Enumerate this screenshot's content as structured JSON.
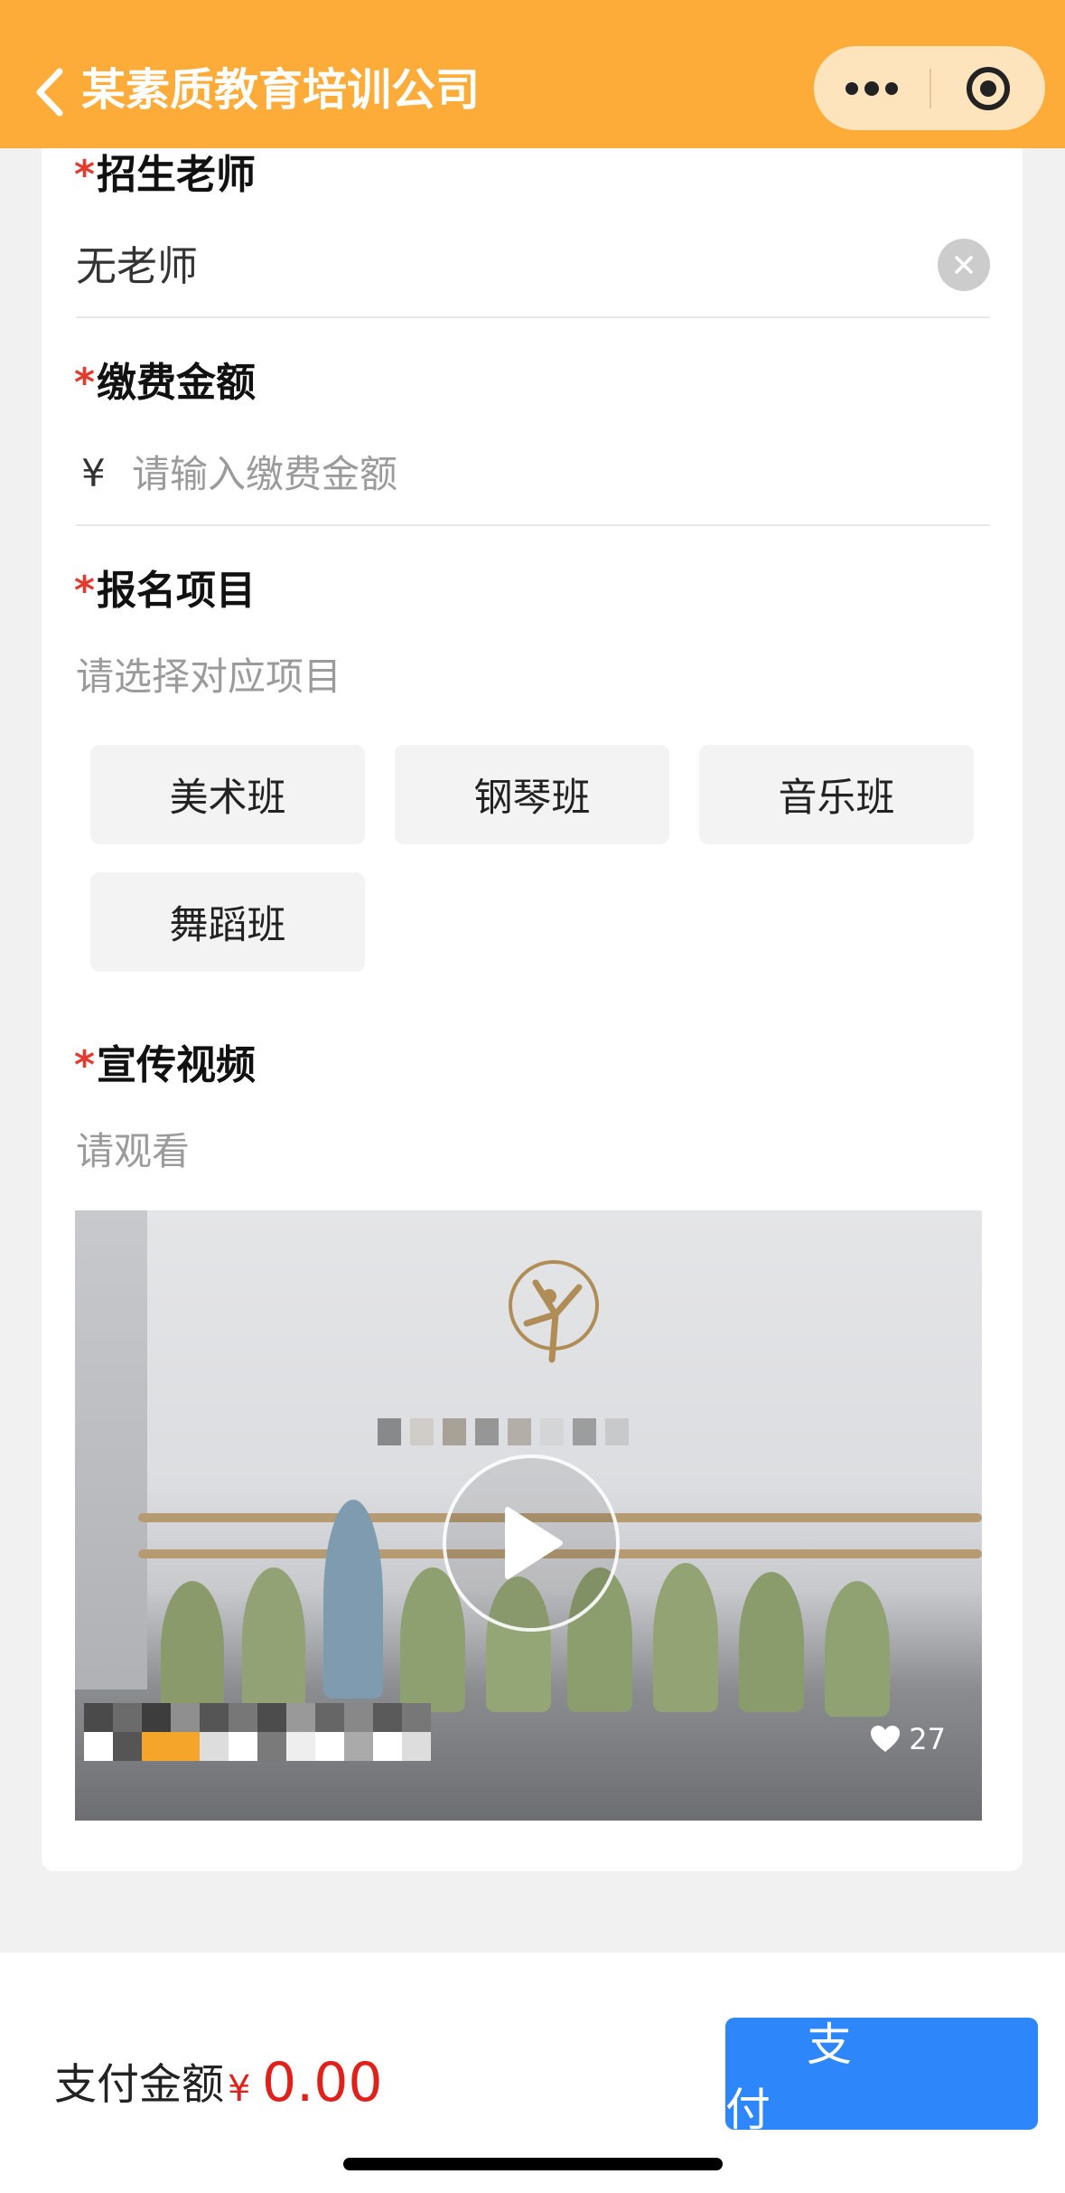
{
  "navbar": {
    "title": "某素质教育培训公司",
    "back_icon": "chevron-left-icon",
    "more_icon": "more-dots-icon",
    "close_icon": "target-circle-icon",
    "background_color": "#FDAC3A"
  },
  "form": {
    "required_mark": "*",
    "teacher": {
      "label": "招生老师",
      "value": "无老师",
      "clear_icon": "clear-icon"
    },
    "amount": {
      "label": "缴费金额",
      "currency_symbol": "¥",
      "placeholder": "请输入缴费金额",
      "value": ""
    },
    "project": {
      "label": "报名项目",
      "hint": "请选择对应项目",
      "options": [
        "美术班",
        "钢琴班",
        "音乐班",
        "舞蹈班"
      ]
    },
    "video": {
      "label": "宣传视频",
      "hint": "请观看",
      "play_icon": "play-icon",
      "like_icon": "heart-icon",
      "like_count": "27"
    }
  },
  "paybar": {
    "label": "支付金额",
    "currency_symbol": "¥",
    "amount": "0.00",
    "pay_button": "支付",
    "accent_color": "#2E86FB",
    "price_color": "#E0201A"
  }
}
